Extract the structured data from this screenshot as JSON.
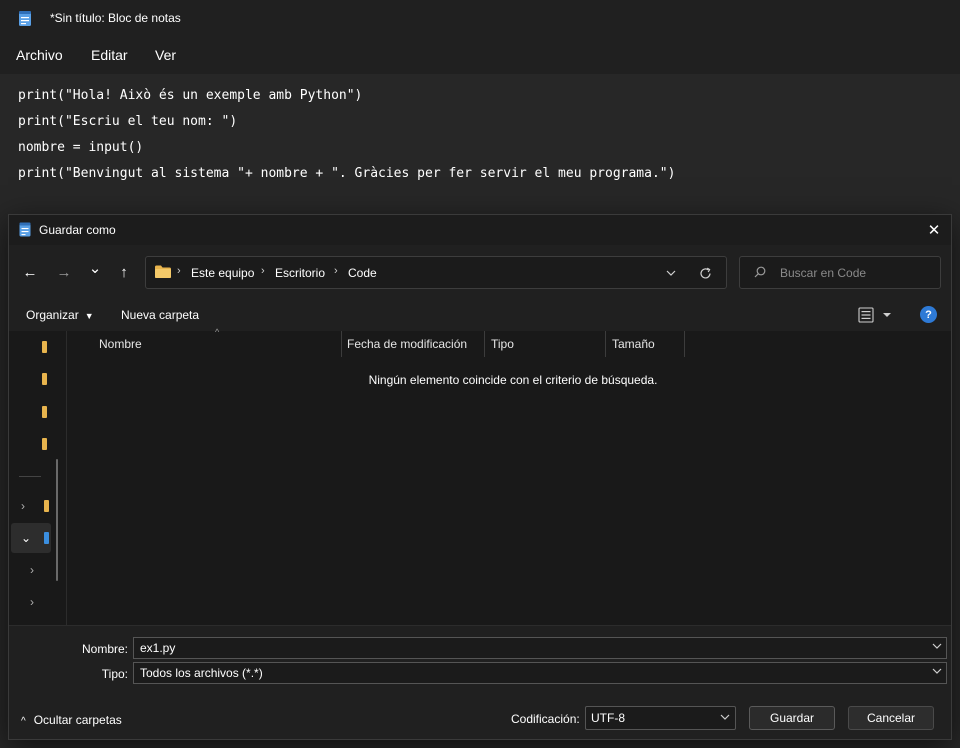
{
  "notepad": {
    "title": "*Sin título: Bloc de notas",
    "menu": [
      "Archivo",
      "Editar",
      "Ver"
    ],
    "code_lines": [
      "print(\"Hola! Això és un exemple amb Python\")",
      "print(\"Escriu el teu nom: \")",
      "nombre = input()",
      "print(\"Benvingut al sistema \"+ nombre + \". Gràcies per fer servir el meu programa.\")"
    ]
  },
  "dialog": {
    "title": "Guardar como",
    "close_glyph": "✕",
    "nav": {
      "back_glyph": "←",
      "forward_glyph": "→",
      "recent_glyph": "⌄",
      "up_glyph": "↑",
      "breadcrumbs": [
        "Este equipo",
        "Escritorio",
        "Code"
      ],
      "separator": "›",
      "search_placeholder": "Buscar en Code"
    },
    "toolbar": {
      "organize_label": "Organizar",
      "new_folder_label": "Nueva carpeta",
      "help_glyph": "?"
    },
    "columns": [
      "Nombre",
      "Fecha de modificación",
      "Tipo",
      "Tamaño"
    ],
    "empty_message": "Ningún elemento coincide con el criterio de búsqueda.",
    "filename_label": "Nombre:",
    "filename_value": "ex1.py",
    "filetype_label": "Tipo:",
    "filetype_value": "Todos los archivos  (*.*)",
    "hide_folders_label": "Ocultar carpetas",
    "encoding_label": "Codificación:",
    "encoding_value": "UTF-8",
    "save_label": "Guardar",
    "cancel_label": "Cancelar"
  },
  "colors": {
    "accent": "#2e7ad6",
    "folder": "#e8b44d",
    "background": "#202020"
  }
}
